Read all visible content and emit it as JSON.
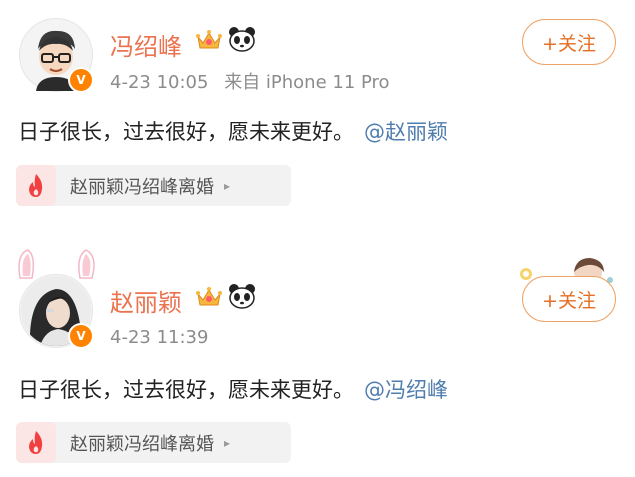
{
  "posts": [
    {
      "author": "冯绍峰",
      "time": "4-23 10:05",
      "source": "来自 iPhone 11 Pro",
      "follow_label": "+关注",
      "text": "日子很长，过去很好，愿未来更好。",
      "mention": "@赵丽颖",
      "topic": "赵丽颖冯绍峰离婚",
      "verified_badge": "V"
    },
    {
      "author": "赵丽颖",
      "time": "4-23 11:39",
      "source": "",
      "follow_label": "+关注",
      "text": "日子很长，过去很好，愿未来更好。",
      "mention": "@冯绍峰",
      "topic": "赵丽颖冯绍峰离婚",
      "verified_badge": "V"
    }
  ],
  "colors": {
    "name": "#eb7350",
    "mention": "#507daf",
    "follow_border": "#f0a366",
    "verified": "#ff8200",
    "fire": "#f04040"
  }
}
